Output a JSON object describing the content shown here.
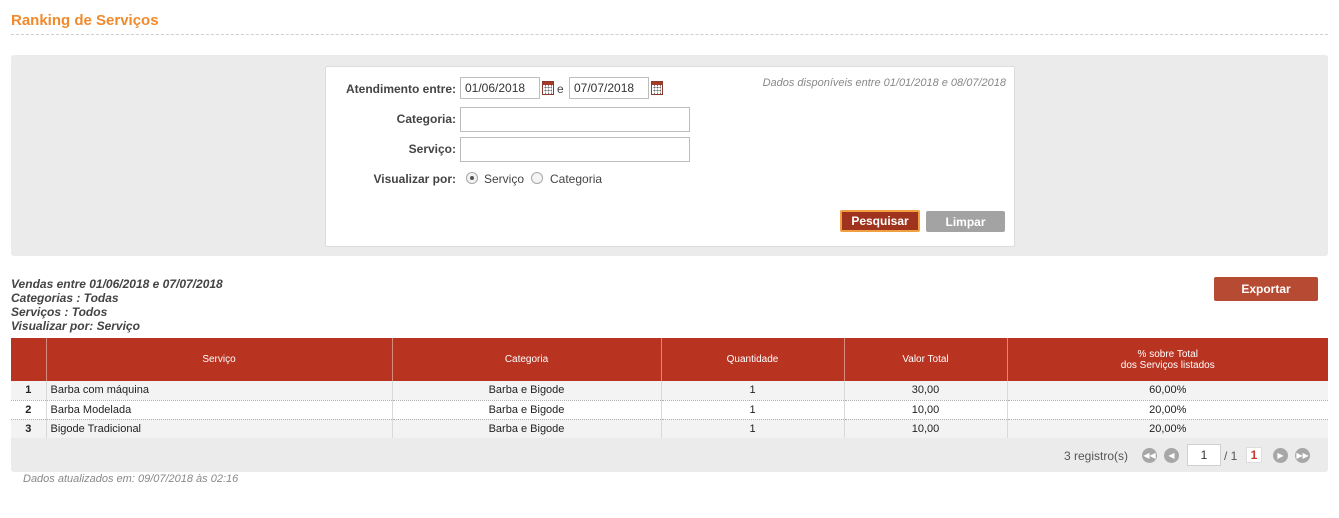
{
  "page": {
    "title": "Ranking de Serviços"
  },
  "filters": {
    "period_label": "Atendimento entre:",
    "start_date": "01/06/2018",
    "conjunction": "e",
    "end_date": "07/07/2018",
    "availability_note": "Dados disponíveis entre 01/01/2018 e 08/07/2018",
    "category_label": "Categoria:",
    "category_value": "",
    "service_label": "Serviço:",
    "service_value": "",
    "view_by_label": "Visualizar por:",
    "view_options": [
      {
        "label": "Serviço",
        "checked": true
      },
      {
        "label": "Categoria",
        "checked": false
      }
    ],
    "search_button": "Pesquisar",
    "clear_button": "Limpar"
  },
  "summary": {
    "line1": "Vendas entre 01/06/2018 e 07/07/2018",
    "line2": "Categorias : Todas",
    "line3": "Serviços : Todos",
    "line4": "Visualizar por: Serviço"
  },
  "export_button": "Exportar",
  "table": {
    "headers": [
      "",
      "Serviço",
      "Categoria",
      "Quantidade",
      "Valor Total",
      "% sobre Total",
      "dos Serviços listados"
    ],
    "rows": [
      {
        "rank": "1",
        "service": "Barba com máquina",
        "category": "Barba e Bigode",
        "quantity": "1",
        "total": "30,00",
        "percent": "60,00%"
      },
      {
        "rank": "2",
        "service": "Barba Modelada",
        "category": "Barba e Bigode",
        "quantity": "1",
        "total": "10,00",
        "percent": "20,00%"
      },
      {
        "rank": "3",
        "service": "Bigode Tradicional",
        "category": "Barba e Bigode",
        "quantity": "1",
        "total": "10,00",
        "percent": "20,00%"
      }
    ]
  },
  "pager": {
    "records": "3 registro(s)",
    "page_input": "1",
    "total_pages": "/ 1",
    "current_page": "1"
  },
  "footer": {
    "updated_note": "Dados atualizados em: 09/07/2018 às 02:16"
  },
  "colors": {
    "title": "#f08a2c",
    "header_red": "#b93321",
    "search_button": "#a0331e",
    "export_button": "#b74a33"
  }
}
